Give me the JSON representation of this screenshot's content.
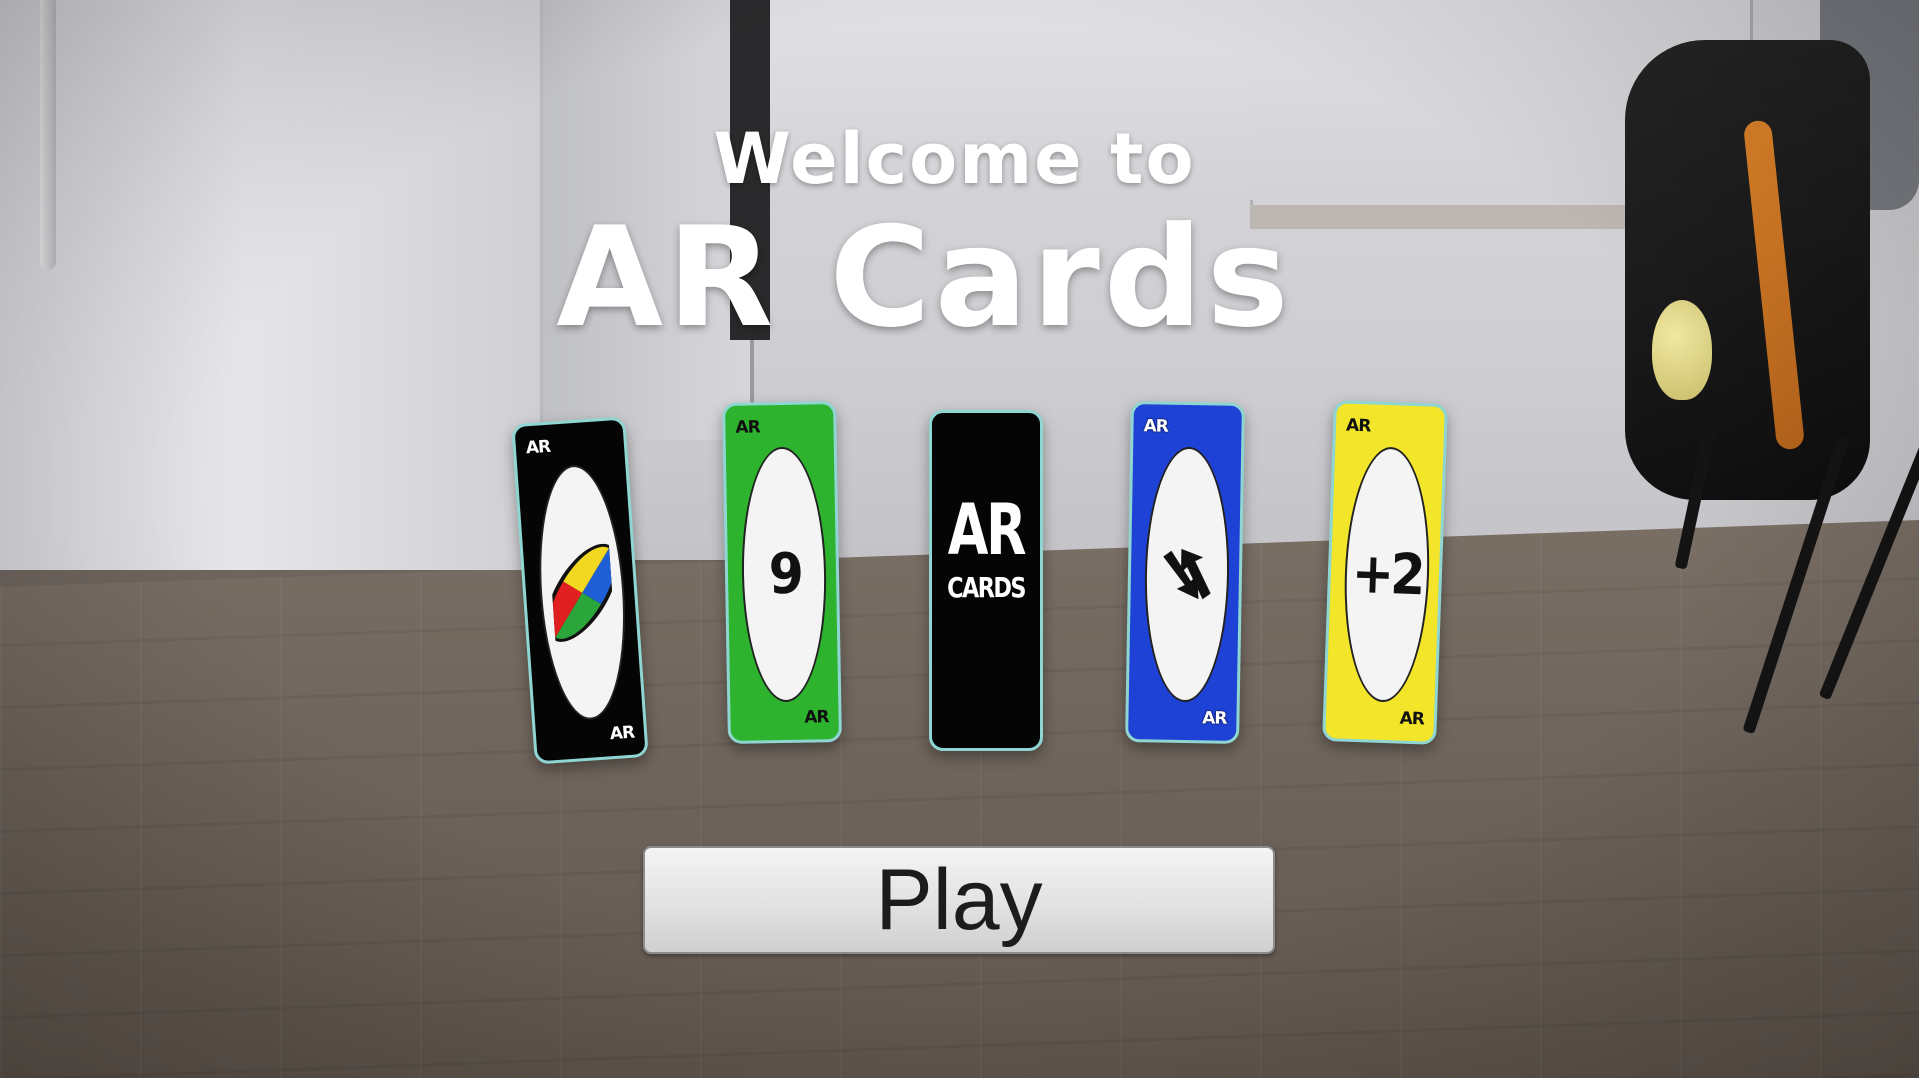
{
  "header": {
    "welcome_text": "Welcome to",
    "title": "AR Cards"
  },
  "cards": [
    {
      "name": "wild-card",
      "color": "#050505",
      "corner_label": "AR",
      "value": "",
      "icon": "wild-color-wheel-icon"
    },
    {
      "name": "nine-card",
      "color": "#2db32d",
      "corner_label": "AR",
      "value": "9"
    },
    {
      "name": "card-back",
      "color": "#050505",
      "back_title": "AR",
      "back_subtitle": "CARDS"
    },
    {
      "name": "reverse-card",
      "color": "#1f42d6",
      "corner_label": "AR",
      "value": "",
      "icon": "reverse-arrows-icon"
    },
    {
      "name": "draw-two-card",
      "color": "#f2e52a",
      "corner_label": "AR",
      "value": "+2"
    }
  ],
  "actions": {
    "play_label": "Play"
  },
  "colors": {
    "card_border": "#8fd6d2",
    "wild_red": "#e02020",
    "wild_blue": "#1f5fd6",
    "wild_green": "#2aa63a",
    "wild_yellow": "#f2d820"
  }
}
